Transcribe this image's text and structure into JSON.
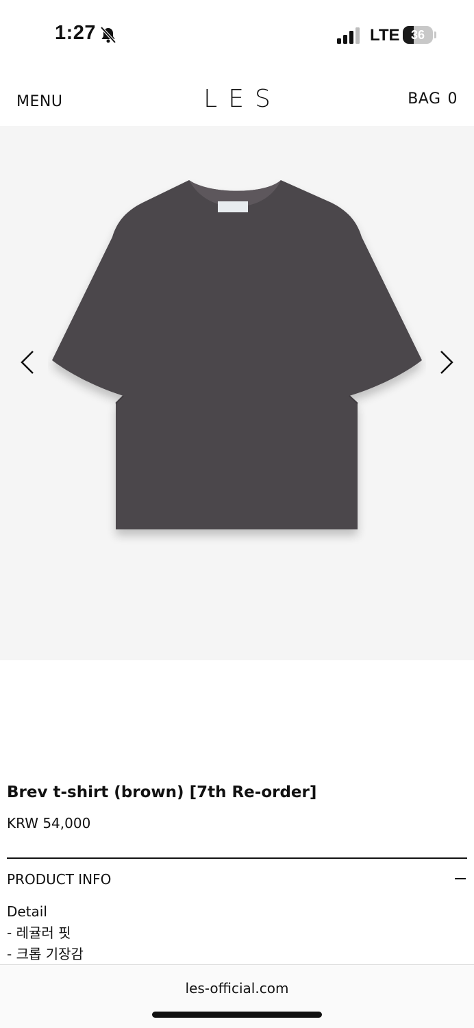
{
  "status_bar": {
    "time": "1:27",
    "network": "LTE",
    "battery": "36",
    "battery_level": 0.36,
    "icons": [
      "bell-slash-icon",
      "signal-icon",
      "battery-icon"
    ]
  },
  "header": {
    "menu_label": "MENU",
    "logo": "LES",
    "bag_label": "BAG",
    "bag_count": "0"
  },
  "gallery": {
    "background": "#f5f5f5",
    "product_color": "#4b474b",
    "prev_icon": "chevron-left-icon",
    "next_icon": "chevron-right-icon"
  },
  "product": {
    "title": "Brev t-shirt (brown) [7th Re-order]",
    "price": "KRW 54,000"
  },
  "product_info": {
    "title": "PRODUCT INFO",
    "toggle_icon": "minus-icon",
    "lines": [
      "Detail",
      "- 레귤러 핏",
      "- 크롭 기장감"
    ]
  },
  "browser": {
    "url": "les-official.com"
  }
}
